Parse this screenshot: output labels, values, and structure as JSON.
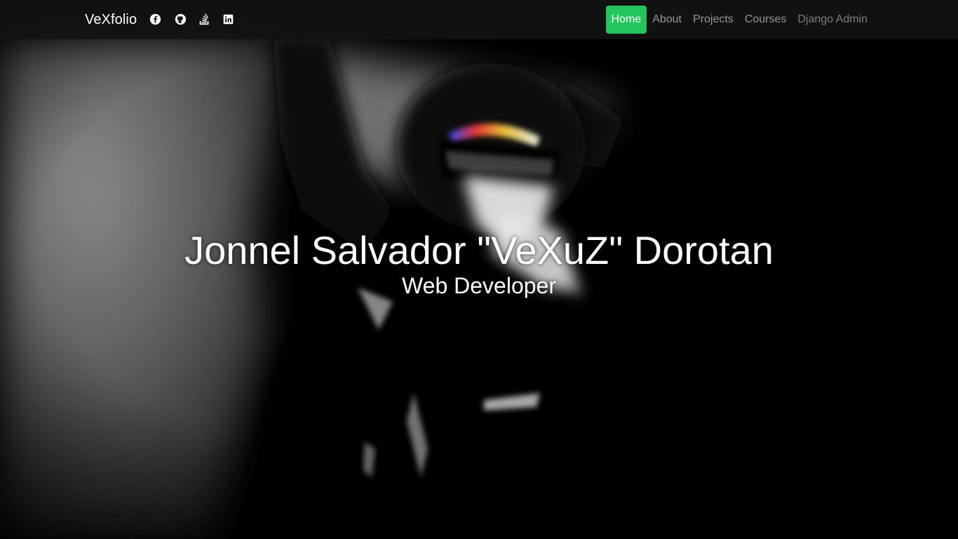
{
  "navbar": {
    "brand": "VeXfolio",
    "social": [
      {
        "icon": "facebook-icon"
      },
      {
        "icon": "github-icon"
      },
      {
        "icon": "stack-overflow-icon"
      },
      {
        "icon": "linkedin-icon"
      }
    ],
    "links": [
      {
        "label": "Home",
        "active": true
      },
      {
        "label": "About",
        "active": false
      },
      {
        "label": "Projects",
        "active": false
      },
      {
        "label": "Courses",
        "active": false
      },
      {
        "label": "Django Admin",
        "active": false
      }
    ]
  },
  "hero": {
    "name": "Jonnel Salvador \"VeXuZ\" Dorotan",
    "role": "Web Developer"
  },
  "colors": {
    "accent": "#22c55e",
    "navbar_bg": "#121212",
    "text": "#ffffff"
  }
}
